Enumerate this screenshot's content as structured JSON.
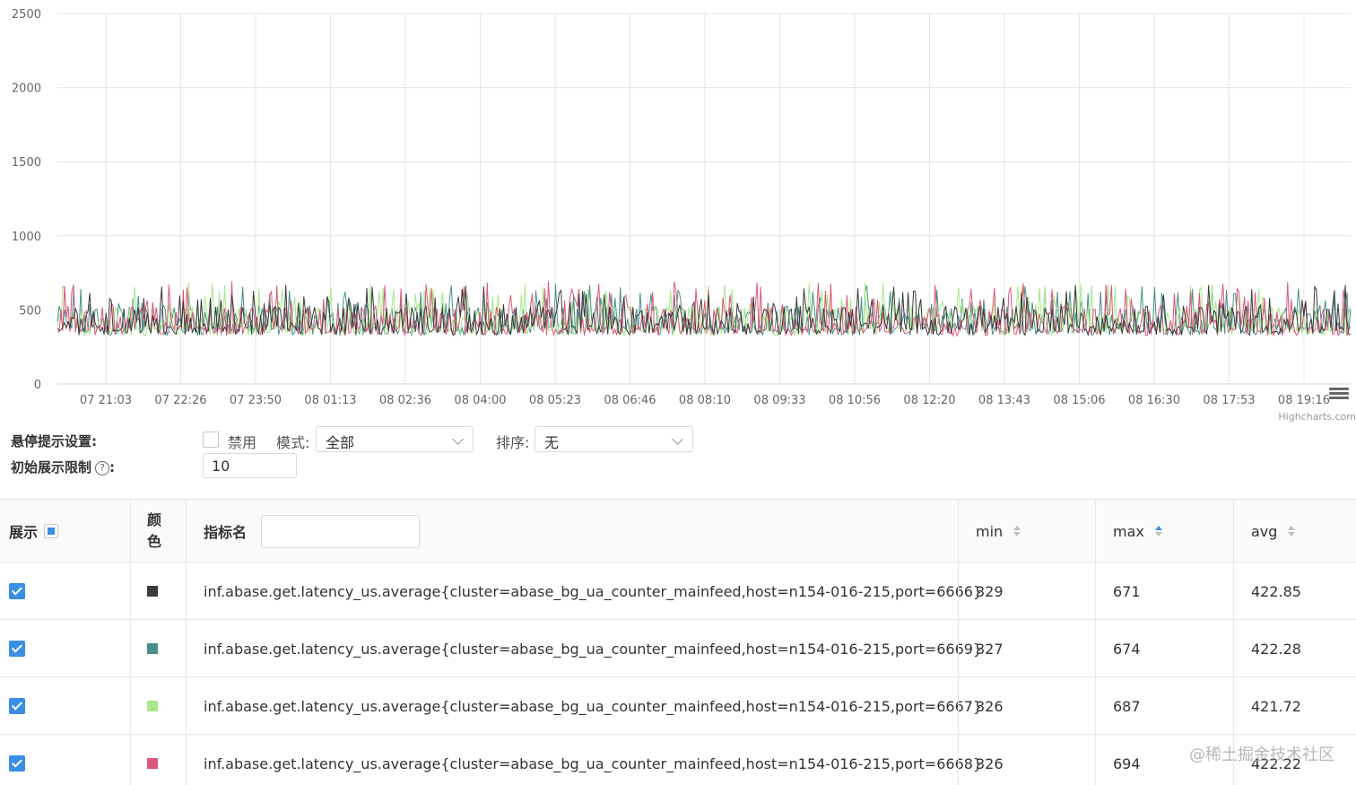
{
  "chart_data": {
    "type": "line",
    "y_ticks": [
      "0",
      "500",
      "1000",
      "1500",
      "2000",
      "2500"
    ],
    "ylim": [
      0,
      2500
    ],
    "x_ticks": [
      "07 21:03",
      "07 22:26",
      "07 23:50",
      "08 01:13",
      "08 02:36",
      "08 04:00",
      "08 05:23",
      "08 06:46",
      "08 08:10",
      "08 09:33",
      "08 10:56",
      "08 12:20",
      "08 13:43",
      "08 15:06",
      "08 16:30",
      "08 17:53",
      "08 19:16"
    ],
    "grid": true,
    "legend": "none",
    "series": [
      {
        "name": "inf.abase.get.latency_us.average{cluster=abase_bg_ua_counter_mainfeed,host=n154-016-215,port=6666}",
        "color": "#3b3b3b",
        "min": 329,
        "max": 671,
        "avg": 422.85
      },
      {
        "name": "inf.abase.get.latency_us.average{cluster=abase_bg_ua_counter_mainfeed,host=n154-016-215,port=6669}",
        "color": "#4a8f8a",
        "min": 327,
        "max": 674,
        "avg": 422.28
      },
      {
        "name": "inf.abase.get.latency_us.average{cluster=abase_bg_ua_counter_mainfeed,host=n154-016-215,port=6667}",
        "color": "#a6e88a",
        "min": 326,
        "max": 687,
        "avg": 421.72
      },
      {
        "name": "inf.abase.get.latency_us.average{cluster=abase_bg_ua_counter_mainfeed,host=n154-016-215,port=6668}",
        "color": "#d9577a",
        "min": 326,
        "max": 694,
        "avg": 422.22
      }
    ],
    "credits": "Highcharts.com"
  },
  "settings": {
    "hover_label": "悬停提示设置:",
    "disable_label": "禁用",
    "mode_label": "模式:",
    "mode_value": "全部",
    "sort_label": "排序:",
    "sort_value": "无",
    "limit_label": "初始展示限制",
    "limit_help": "?",
    "limit_colon": ":",
    "limit_value": "10"
  },
  "table": {
    "headers": {
      "show": "展示",
      "color": "颜\n色",
      "name": "指标名",
      "min": "min",
      "max": "max",
      "avg": "avg"
    },
    "rows": [
      {
        "name": "inf.abase.get.latency_us.average{cluster=abase_bg_ua_counter_mainfeed,host=n154-016-215,port=6666}",
        "min": "329",
        "max": "671",
        "avg": "422.85"
      },
      {
        "name": "inf.abase.get.latency_us.average{cluster=abase_bg_ua_counter_mainfeed,host=n154-016-215,port=6669}",
        "min": "327",
        "max": "674",
        "avg": "422.28"
      },
      {
        "name": "inf.abase.get.latency_us.average{cluster=abase_bg_ua_counter_mainfeed,host=n154-016-215,port=6667}",
        "min": "326",
        "max": "687",
        "avg": "421.72"
      },
      {
        "name": "inf.abase.get.latency_us.average{cluster=abase_bg_ua_counter_mainfeed,host=n154-016-215,port=6668}",
        "min": "326",
        "max": "694",
        "avg": "422.22"
      }
    ]
  },
  "watermark": "@稀土掘金技术社区"
}
